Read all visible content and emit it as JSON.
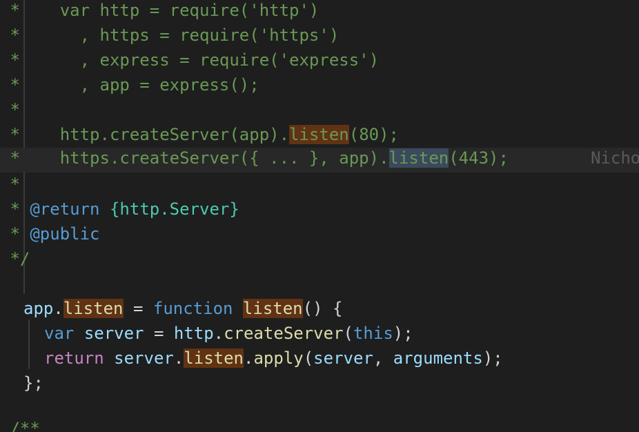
{
  "code": {
    "l1": {
      "star": " *",
      "text": "    var http = require('http')"
    },
    "l2": {
      "star": " *",
      "text": "      , https = require('https')"
    },
    "l3": {
      "star": " *",
      "text": "      , express = require('express')"
    },
    "l4": {
      "star": " *",
      "text": "      , app = express();"
    },
    "l5": {
      "star": " *"
    },
    "l6": {
      "star": " *",
      "pre": "    http.createServer(app).",
      "word": "listen",
      "post": "(80);"
    },
    "l7": {
      "star": " *",
      "pre": "    https.createServer({ ... }, app).",
      "word": "listen",
      "post": "(443);"
    },
    "l8": {
      "star": " *"
    },
    "l9": {
      "star": " * ",
      "tag": "@return",
      "sp": " ",
      "type": "{http.Server}"
    },
    "l10": {
      "star": " * ",
      "tag": "@public"
    },
    "l11": {
      "end": " */"
    },
    "l13": {
      "obj": "app",
      "dot": ".",
      "prop": "listen",
      "eq": " = ",
      "kw": "function",
      "sp": " ",
      "name": "listen",
      "rest": "() {"
    },
    "l14": {
      "ind": "    ",
      "kw": "var",
      "sp1": " ",
      "v": "server",
      "eq": " = ",
      "obj": "http",
      "dot": ".",
      "fn": "createServer",
      "p1": "(",
      "this": "this",
      "p2": ");"
    },
    "l15": {
      "ind": "    ",
      "kw": "return",
      "sp1": " ",
      "v": "server",
      "dot1": ".",
      "word": "listen",
      "dot2": ".",
      "fn": "apply",
      "p1": "(",
      "a1": "server",
      "comma": ", ",
      "a2": "arguments",
      "p2": ");"
    },
    "l16": {
      "text": "};"
    },
    "l18": {
      "text": " /**"
    }
  },
  "blame": "Nicho",
  "colors": {
    "background": "#1e1e1e",
    "comment": "#6a9955",
    "keyword": "#569cd6",
    "control": "#c586c0",
    "function": "#dcdcaa",
    "variable": "#9cdcfe",
    "type": "#4ec9b0",
    "highlight": "#613214",
    "selection": "#3a4a5c"
  }
}
